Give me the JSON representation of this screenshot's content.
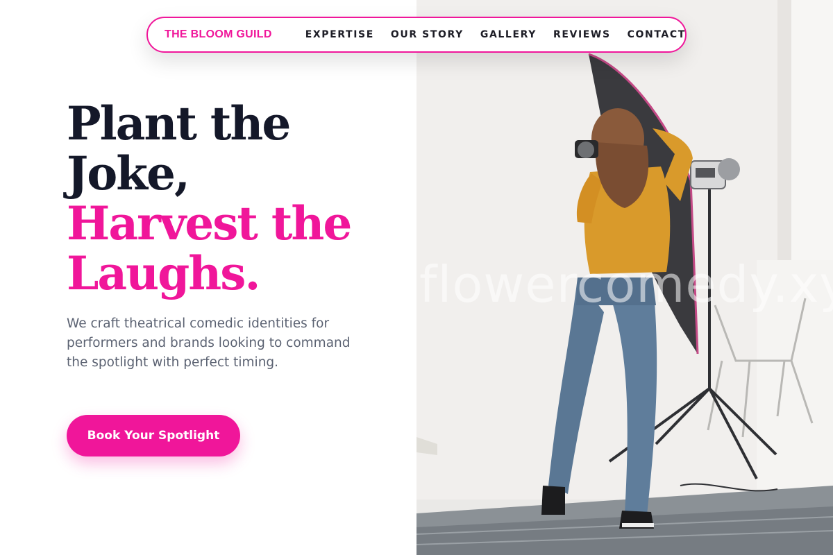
{
  "nav": {
    "brand": "THE BLOOM GUILD",
    "links": [
      "EXPERTISE",
      "OUR STORY",
      "GALLERY",
      "REVIEWS",
      "CONTACT"
    ]
  },
  "hero": {
    "headline_dark_1": "Plant the",
    "headline_dark_2": "Joke,",
    "headline_pink_1": "Harvest the",
    "headline_pink_2": "Laughs.",
    "subtext": "We craft theatrical comedic identities for performers and brands looking to command the spotlight with perfect timing.",
    "cta_label": "Book Your Spotlight"
  },
  "photo": {
    "watermark": "flowercomedy.xyz"
  },
  "colors": {
    "accent": "#f0169a",
    "heading": "#141829",
    "body_text": "#5b6272"
  }
}
